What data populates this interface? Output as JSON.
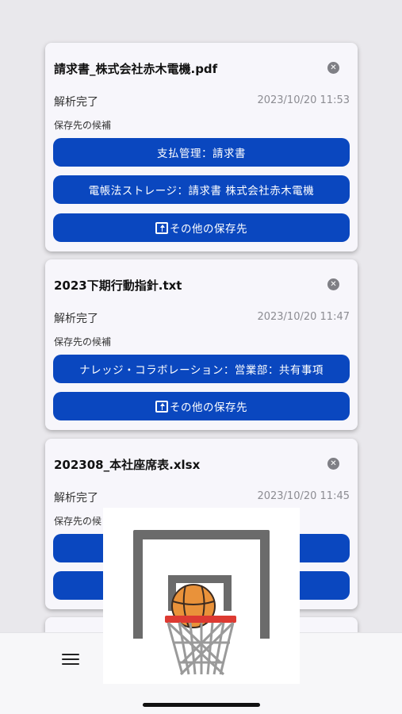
{
  "cards": [
    {
      "filename": "請求書_株式会社赤木電機.pdf",
      "status": "解析完了",
      "timestamp": "2023/10/20 11:53",
      "candidates_label": "保存先の候補",
      "buttons": [
        "支払管理：請求書",
        "電帳法ストレージ：請求書 株式会社赤木電機"
      ],
      "other_label": "その他の保存先"
    },
    {
      "filename": "2023下期行動指針.txt",
      "status": "解析完了",
      "timestamp": "2023/10/20 11:47",
      "candidates_label": "保存先の候補",
      "buttons": [
        "ナレッジ・コラボレーション：営業部：共有事項"
      ],
      "other_label": "その他の保存先"
    },
    {
      "filename": "202308_本社座席表.xlsx",
      "status": "解析完了",
      "timestamp": "2023/10/20 11:45",
      "candidates_label": "保存先の候",
      "buttons": [
        "",
        ""
      ]
    }
  ],
  "colors": {
    "accent": "#0a47bf",
    "background": "#e9e8ec",
    "card": "#f7f6fb",
    "rim": "#dd3a32",
    "ball": "#e9923a"
  },
  "icons": {
    "close": "close-circle-icon",
    "upload": "upload-icon",
    "menu": "hamburger-menu-icon",
    "hoop": "basketball-hoop-icon"
  }
}
